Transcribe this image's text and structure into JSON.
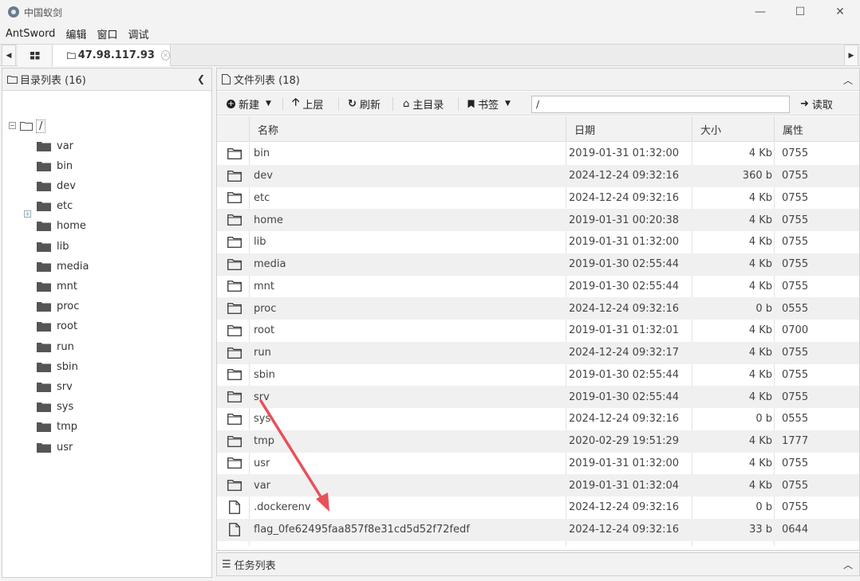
{
  "window": {
    "title": "中国蚁剑",
    "minimize_glyph": "—",
    "maximize_glyph": "☐",
    "close_glyph": "✕"
  },
  "menu": [
    "AntSword",
    "编辑",
    "窗口",
    "调试"
  ],
  "tabs": {
    "active_label": "47.98.117.93",
    "left_arrow": "◀",
    "right_arrow": "▶"
  },
  "dir_panel": {
    "title": "目录列表 (16)",
    "root": "/",
    "items": [
      "var",
      "bin",
      "dev",
      "etc",
      "home",
      "lib",
      "media",
      "mnt",
      "proc",
      "root",
      "run",
      "sbin",
      "srv",
      "sys",
      "tmp",
      "usr"
    ]
  },
  "file_panel": {
    "title": "文件列表 (18)",
    "toolbar": {
      "new": "新建",
      "up": "上层",
      "refresh": "刷新",
      "home": "主目录",
      "bookmark": "书签",
      "path": "/",
      "read": "读取"
    },
    "columns": {
      "name": "名称",
      "date": "日期",
      "size": "大小",
      "perm": "属性"
    },
    "rows": [
      {
        "type": "folder",
        "name": "bin",
        "date": "2019-01-31 01:32:00",
        "size": "4 Kb",
        "perm": "0755"
      },
      {
        "type": "folder",
        "name": "dev",
        "date": "2024-12-24 09:32:16",
        "size": "360 b",
        "perm": "0755"
      },
      {
        "type": "folder",
        "name": "etc",
        "date": "2024-12-24 09:32:16",
        "size": "4 Kb",
        "perm": "0755"
      },
      {
        "type": "folder",
        "name": "home",
        "date": "2019-01-31 00:20:38",
        "size": "4 Kb",
        "perm": "0755"
      },
      {
        "type": "folder",
        "name": "lib",
        "date": "2019-01-31 01:32:00",
        "size": "4 Kb",
        "perm": "0755"
      },
      {
        "type": "folder",
        "name": "media",
        "date": "2019-01-30 02:55:44",
        "size": "4 Kb",
        "perm": "0755"
      },
      {
        "type": "folder",
        "name": "mnt",
        "date": "2019-01-30 02:55:44",
        "size": "4 Kb",
        "perm": "0755"
      },
      {
        "type": "folder",
        "name": "proc",
        "date": "2024-12-24 09:32:16",
        "size": "0 b",
        "perm": "0555"
      },
      {
        "type": "folder",
        "name": "root",
        "date": "2019-01-31 01:32:01",
        "size": "4 Kb",
        "perm": "0700"
      },
      {
        "type": "folder",
        "name": "run",
        "date": "2024-12-24 09:32:17",
        "size": "4 Kb",
        "perm": "0755"
      },
      {
        "type": "folder",
        "name": "sbin",
        "date": "2019-01-30 02:55:44",
        "size": "4 Kb",
        "perm": "0755"
      },
      {
        "type": "folder",
        "name": "srv",
        "date": "2019-01-30 02:55:44",
        "size": "4 Kb",
        "perm": "0755"
      },
      {
        "type": "folder",
        "name": "sys",
        "date": "2024-12-24 09:32:16",
        "size": "0 b",
        "perm": "0555"
      },
      {
        "type": "folder",
        "name": "tmp",
        "date": "2020-02-29 19:51:29",
        "size": "4 Kb",
        "perm": "1777"
      },
      {
        "type": "folder",
        "name": "usr",
        "date": "2019-01-31 01:32:00",
        "size": "4 Kb",
        "perm": "0755"
      },
      {
        "type": "folder",
        "name": "var",
        "date": "2019-01-31 01:32:04",
        "size": "4 Kb",
        "perm": "0755"
      },
      {
        "type": "file",
        "name": ".dockerenv",
        "date": "2024-12-24 09:32:16",
        "size": "0 b",
        "perm": "0755"
      },
      {
        "type": "file",
        "name": "flag_0fe62495faa857f8e31cd5d52f72fedf",
        "date": "2024-12-24 09:32:16",
        "size": "33 b",
        "perm": "0644"
      }
    ]
  },
  "task_panel": {
    "title": "任务列表"
  },
  "colors": {
    "annotation_arrow": "#e8505b",
    "folder_dark": "#555555",
    "header_bg": "#f2f2f2"
  }
}
